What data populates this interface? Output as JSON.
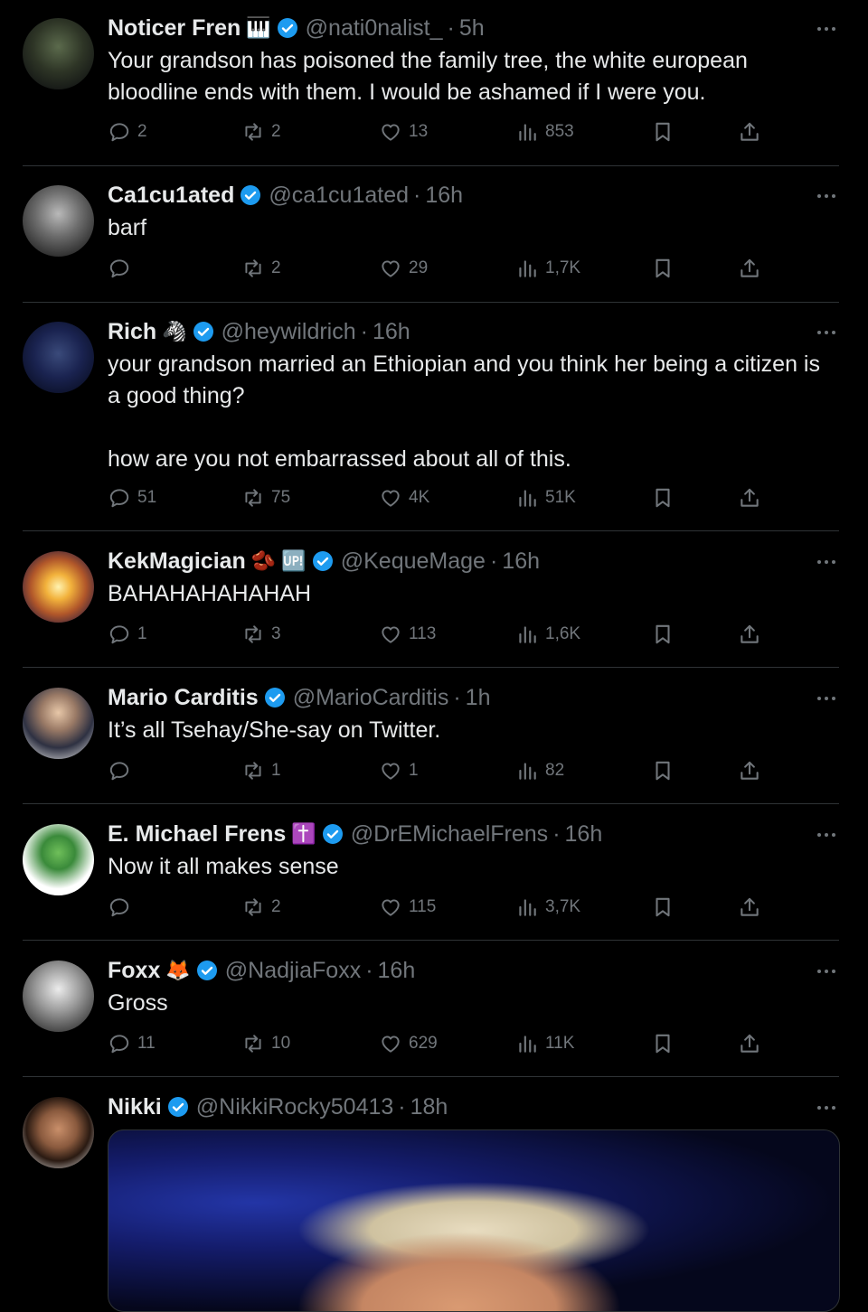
{
  "tweets": [
    {
      "name": "Noticer Fren",
      "emoji": "🎹",
      "handle": "@nati0nalist_",
      "time": "5h",
      "text": "Your grandson has poisoned the family tree, the white european bloodline ends with them. I would be ashamed if I were you.",
      "replies": "2",
      "reposts": "2",
      "likes": "13",
      "views": "853"
    },
    {
      "name": "Ca1cu1ated",
      "emoji": "",
      "handle": "@ca1cu1ated",
      "time": "16h",
      "text": "barf",
      "replies": "",
      "reposts": "2",
      "likes": "29",
      "views": "1,7K"
    },
    {
      "name": "Rich",
      "emoji": "🦓",
      "handle": "@heywildrich",
      "time": "16h",
      "text": "your grandson married an Ethiopian and you think her being a citizen is a good thing?\n\nhow are you not embarrassed about all of this.",
      "replies": "51",
      "reposts": "75",
      "likes": "4K",
      "views": "51K"
    },
    {
      "name": "KekMagician",
      "emoji": "🫘 🆙",
      "handle": "@KequeMage",
      "time": "16h",
      "text": "BAHAHAHAHAHAH",
      "replies": "1",
      "reposts": "3",
      "likes": "113",
      "views": "1,6K"
    },
    {
      "name": "Mario Carditis",
      "emoji": "",
      "handle": "@MarioCarditis",
      "time": "1h",
      "text": "It’s all Tsehay/She-say on Twitter.",
      "replies": "",
      "reposts": "1",
      "likes": "1",
      "views": "82"
    },
    {
      "name": "E. Michael Frens",
      "emoji": "✝️",
      "handle": "@DrEMichaelFrens",
      "time": "16h",
      "text": "Now it all makes sense",
      "replies": "",
      "reposts": "2",
      "likes": "115",
      "views": "3,7K"
    },
    {
      "name": "Foxx",
      "emoji": "🦊",
      "handle": "@NadjiaFoxx",
      "time": "16h",
      "text": "Gross",
      "replies": "11",
      "reposts": "10",
      "likes": "629",
      "views": "11K"
    },
    {
      "name": "Nikki",
      "emoji": "",
      "handle": "@NikkiRocky50413",
      "time": "18h",
      "text": "",
      "replies": "",
      "reposts": "",
      "likes": "",
      "views": ""
    }
  ],
  "dot": "·",
  "colors": {
    "background": "#000000",
    "text": "#e7e9ea",
    "muted": "#71767b",
    "verified": "#1d9bf0",
    "divider": "#2f3336"
  },
  "icons": [
    "reply-icon",
    "repost-icon",
    "like-icon",
    "views-icon",
    "bookmark-icon",
    "share-icon",
    "more-icon",
    "verified-badge-icon"
  ]
}
